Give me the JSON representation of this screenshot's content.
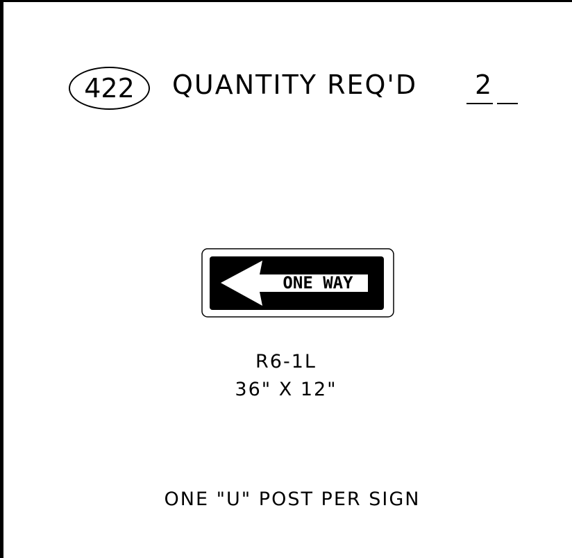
{
  "header": {
    "sign_number": "422",
    "quantity_label": "QUANTITY REQ'D",
    "quantity_value": "2"
  },
  "sign": {
    "legend": "ONE WAY",
    "arrow_direction": "left",
    "colors": {
      "background": "#000000",
      "legend": "#ffffff",
      "border": "#000000"
    }
  },
  "spec": {
    "code": "R6-1L",
    "size": "36\" X 12\""
  },
  "note": "ONE \"U\" POST PER SIGN"
}
